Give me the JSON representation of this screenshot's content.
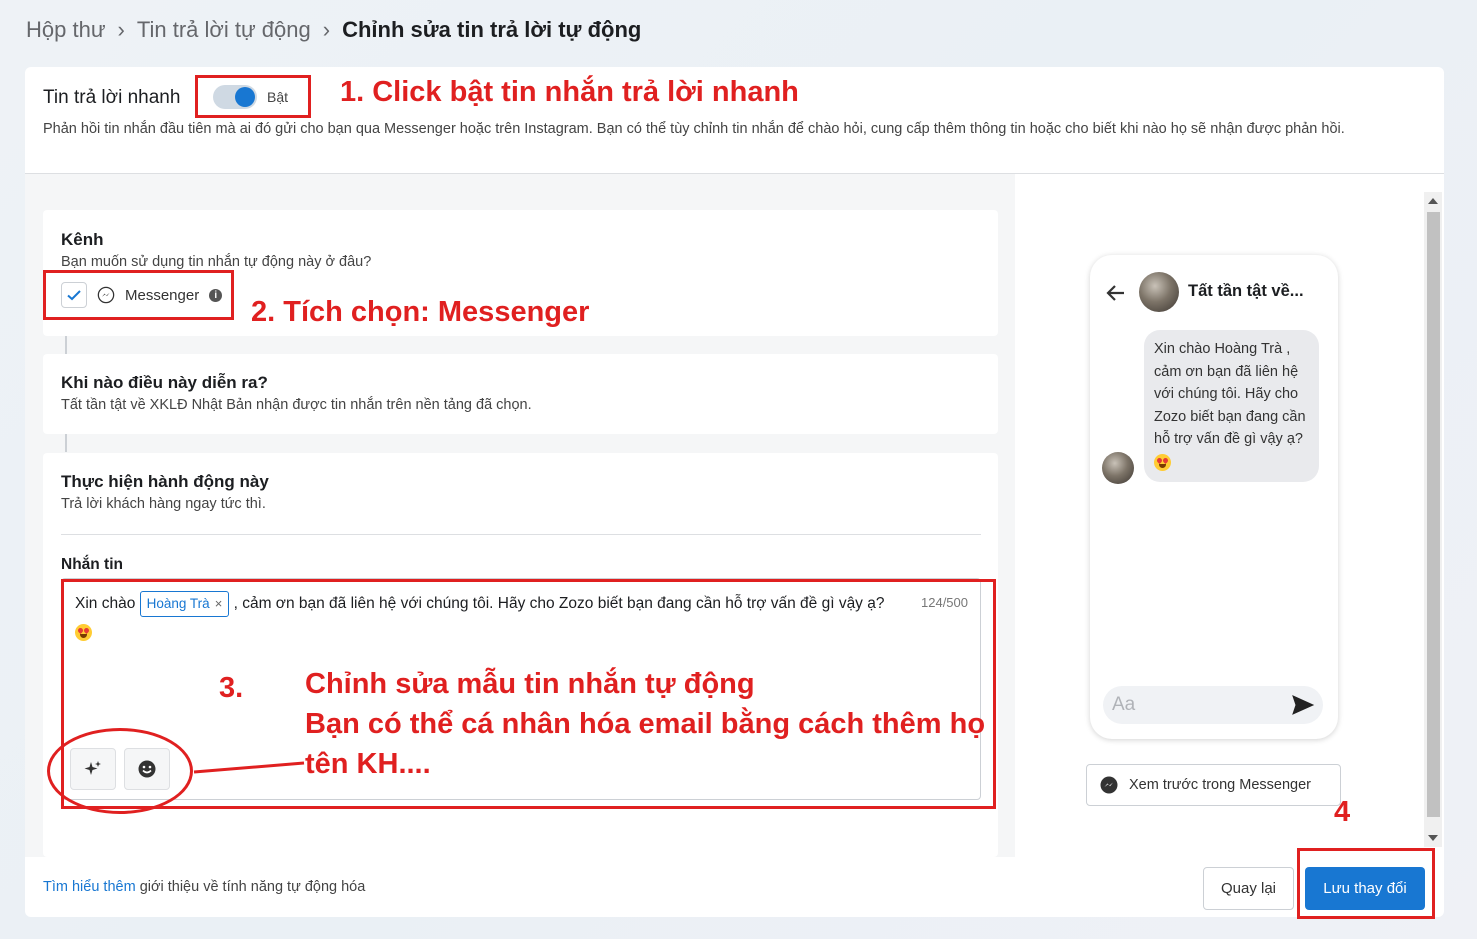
{
  "breadcrumb": {
    "items": [
      "Hộp thư",
      "Tin trả lời tự động",
      "Chỉnh sửa tin trả lời tự động"
    ]
  },
  "header": {
    "title": "Tin trả lời nhanh",
    "toggle_label": "Bật",
    "toggle_on": true,
    "description": "Phản hồi tin nhắn đầu tiên mà ai đó gửi cho bạn qua Messenger hoặc trên Instagram. Bạn có thể tùy chỉnh tin nhắn để chào hỏi, cung cấp thêm thông tin hoặc cho biết khi nào họ sẽ nhận được phản hồi."
  },
  "channel": {
    "title": "Kênh",
    "subtitle": "Bạn muốn sử dụng tin nhắn tự động này ở đâu?",
    "option_label": "Messenger",
    "checked": true
  },
  "trigger": {
    "title": "Khi nào điều này diễn ra?",
    "subtitle": "Tất tần tật về XKLĐ Nhật Bản nhận được tin nhắn trên nền tảng đã chọn."
  },
  "action": {
    "title": "Thực hiện hành động này",
    "subtitle": "Trả lời khách hàng ngay tức thì.",
    "message_label": "Nhắn tin",
    "message_prefix": "Xin chào",
    "name_chip": "Hoàng Trà",
    "message_suffix": ", cảm ơn bạn đã liên hệ với chúng tôi. Hãy cho Zozo biết bạn đang cần hỗ trợ vấn đề gì vậy ạ?",
    "counter": "124/500"
  },
  "preview": {
    "page_name": "Tất tần tật về...",
    "bubble_text": "Xin chào Hoàng Trà , cảm ơn bạn đã liên hệ với chúng tôi. Hãy cho Zozo biết bạn đang cần hỗ trợ vấn đề gì vậy ạ?",
    "composer_placeholder": "Aa",
    "preview_button": "Xem trước trong Messenger"
  },
  "footer": {
    "link_text": "Tìm hiểu thêm",
    "text": "giới thiệu về tính năng tự động hóa",
    "back_button": "Quay lại",
    "save_button": "Lưu thay đổi"
  },
  "annotations": {
    "step1": "1. Click bật tin nhắn trả lời nhanh",
    "step2": "2. Tích chọn: Messenger",
    "step3_num": "3.",
    "step3_line1": "Chỉnh sửa mẫu tin nhắn tự động",
    "step3_line2": "Bạn có thể cá nhân hóa email bằng cách thêm họ",
    "step3_line3": "tên KH....",
    "step4": "4",
    "color": "#e02020"
  },
  "colors": {
    "accent": "#1877d2",
    "annotation": "#e02020"
  }
}
